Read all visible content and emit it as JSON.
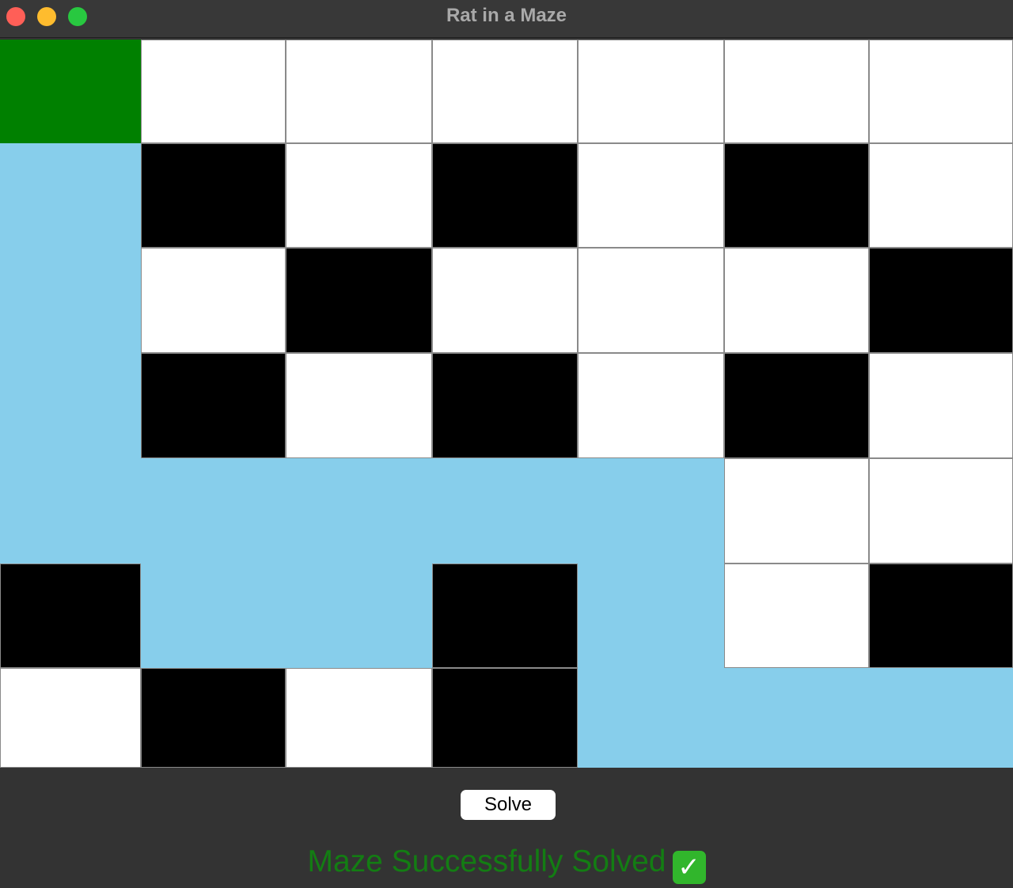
{
  "window": {
    "title": "Rat in a Maze"
  },
  "maze": {
    "rows": 7,
    "cols": 7,
    "colors": {
      "open": "#ffffff",
      "wall": "#000000",
      "path": "#87ceeb",
      "start": "#008000"
    },
    "cells": [
      [
        "start",
        "open",
        "open",
        "open",
        "open",
        "open",
        "open"
      ],
      [
        "path",
        "wall",
        "open",
        "wall",
        "open",
        "wall",
        "open"
      ],
      [
        "path",
        "open",
        "wall",
        "open",
        "open",
        "open",
        "wall"
      ],
      [
        "path",
        "wall",
        "open",
        "wall",
        "open",
        "wall",
        "open"
      ],
      [
        "path",
        "path",
        "path",
        "path",
        "path",
        "open",
        "open"
      ],
      [
        "wall",
        "path",
        "path",
        "wall",
        "path",
        "open",
        "wall"
      ],
      [
        "open",
        "wall",
        "open",
        "wall",
        "path",
        "path",
        "path"
      ]
    ]
  },
  "controls": {
    "solve_label": "Solve"
  },
  "status": {
    "message": "Maze Successfully Solved",
    "icon": "check-mark-icon",
    "icon_glyph": "✓",
    "color": "#137d13"
  }
}
